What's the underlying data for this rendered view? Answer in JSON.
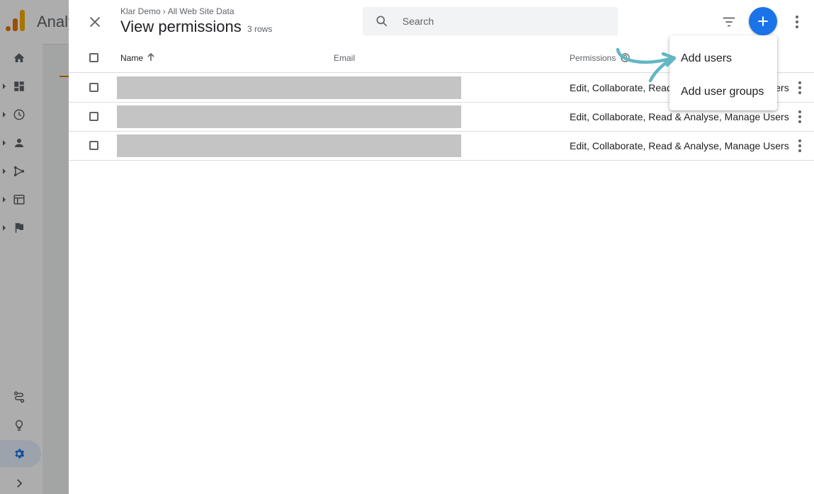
{
  "background_app": {
    "app_name": "Analy",
    "rail_icons": [
      "home-icon",
      "dashboard-icon",
      "clock-icon",
      "person-icon",
      "fork-icon",
      "window-icon",
      "flag-icon",
      "route-icon",
      "lightbulb-icon",
      "gear-icon",
      "chevron-right-icon"
    ]
  },
  "panel": {
    "breadcrumb": [
      "Klar Demo",
      "All Web Site Data"
    ],
    "breadcrumb_separator": "›",
    "title": "View permissions",
    "row_count": "3 rows",
    "search_placeholder": "Search",
    "add_button_color": "#1a73e8"
  },
  "table": {
    "columns": {
      "name": "Name",
      "email": "Email",
      "permissions": "Permissions"
    },
    "rows": [
      {
        "permissions": "Edit, Collaborate, Read & Analyse, Manage Users"
      },
      {
        "permissions": "Edit, Collaborate, Read & Analyse, Manage Users"
      },
      {
        "permissions": "Edit, Collaborate, Read & Analyse, Manage Users"
      }
    ]
  },
  "menu": {
    "items": [
      {
        "label": "Add users"
      },
      {
        "label": "Add user groups"
      }
    ]
  },
  "colors": {
    "accent_blue": "#1a73e8",
    "annotation_teal": "#62b6c4",
    "redaction_gray": "#c4c4c4"
  }
}
